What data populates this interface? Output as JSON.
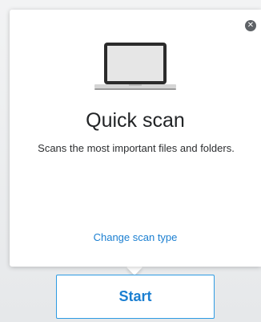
{
  "popover": {
    "close_icon": "close-icon",
    "illustration_icon": "laptop-icon",
    "title": "Quick scan",
    "description": "Scans the most important files and folders.",
    "change_link": "Change scan type"
  },
  "actions": {
    "start_label": "Start"
  },
  "colors": {
    "accent": "#1b7fd1",
    "button_border": "#2e9be3",
    "close_bg": "#5e6266",
    "background": "#e9ebed"
  }
}
